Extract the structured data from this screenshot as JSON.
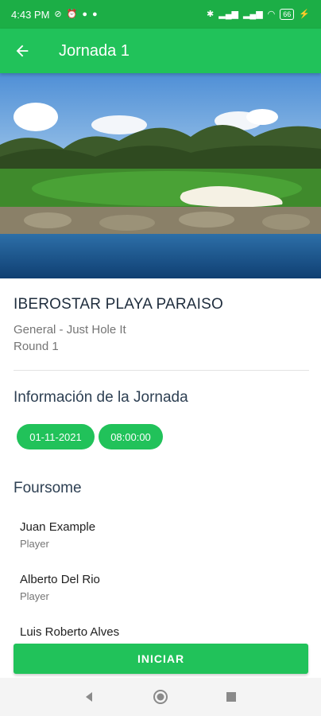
{
  "status": {
    "time": "4:43 PM",
    "battery": "66"
  },
  "app_bar": {
    "title": "Jornada 1"
  },
  "course": {
    "name": "IBEROSTAR PLAYA PARAISO",
    "subtitle": "General - Just Hole It",
    "round": "Round 1"
  },
  "info": {
    "title": "Información de la Jornada",
    "date": "01-11-2021",
    "time": "08:00:00"
  },
  "foursome": {
    "title": "Foursome",
    "players": [
      {
        "name": "Juan Example",
        "role": "Player"
      },
      {
        "name": "Alberto Del Rio",
        "role": "Player"
      },
      {
        "name": "Luis Roberto Alves",
        "role": ""
      }
    ]
  },
  "actions": {
    "start_label": "INICIAR"
  },
  "colors": {
    "primary": "#21c25a",
    "status_bar": "#1cae46"
  },
  "icons": [
    "back-arrow-icon",
    "nav-back-icon",
    "nav-home-icon",
    "nav-recents-icon"
  ]
}
